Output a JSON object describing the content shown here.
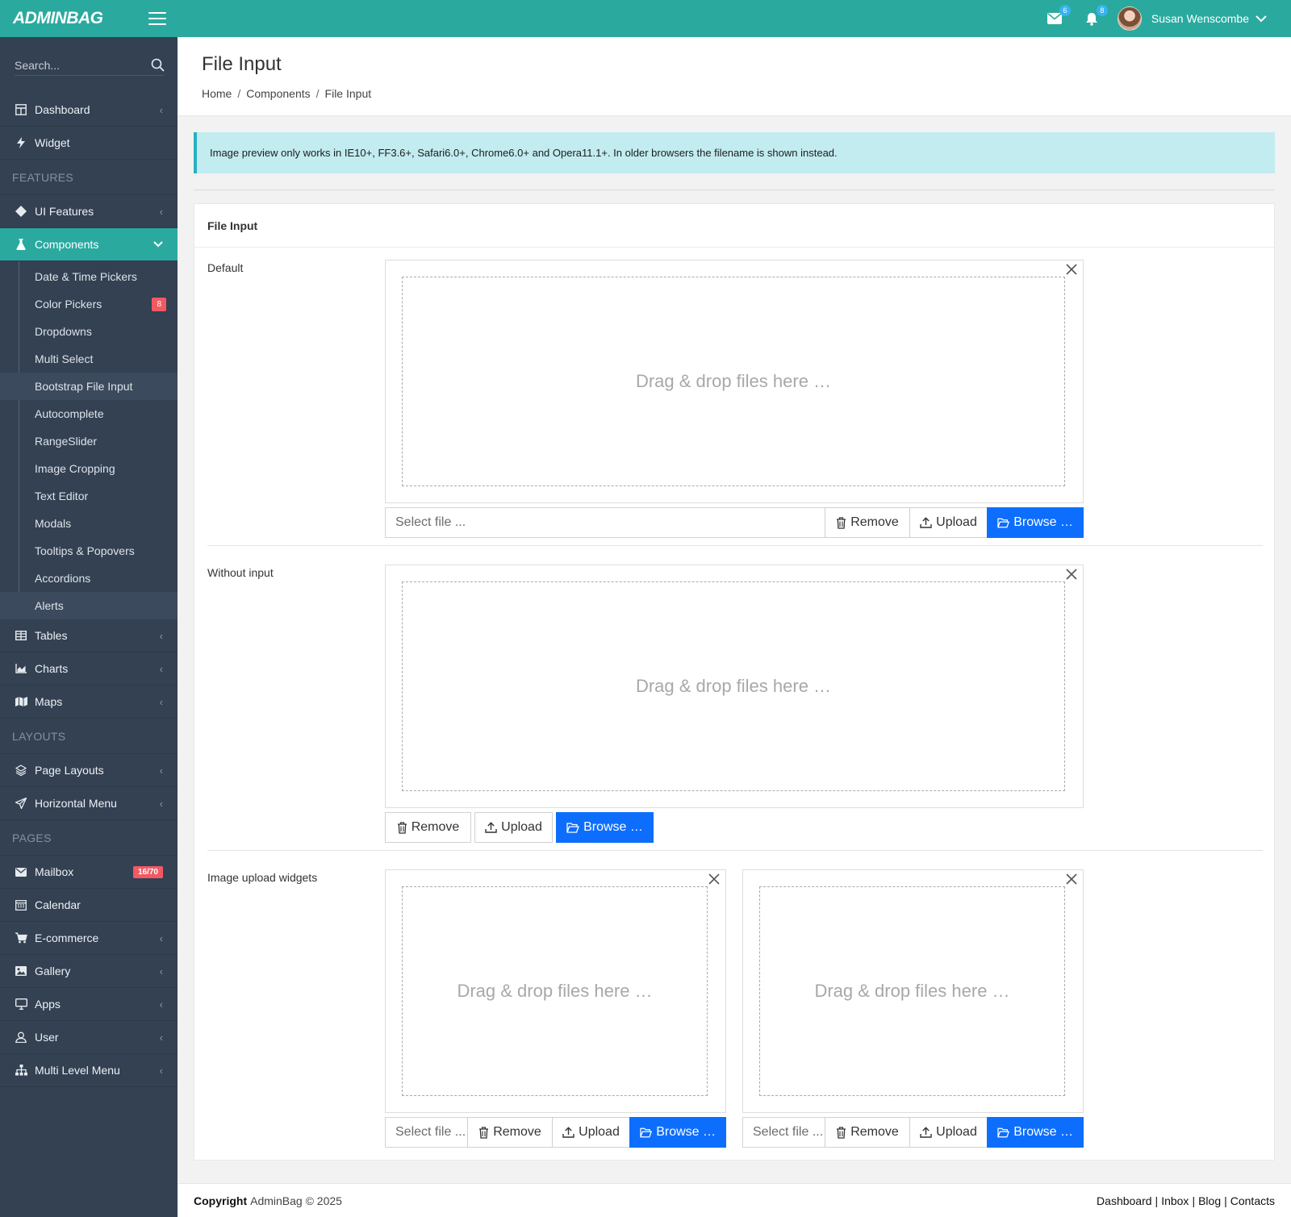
{
  "header": {
    "brand": "ADMINBAG",
    "mail_count": "6",
    "notification_count": "8",
    "username": "Susan Wenscombe"
  },
  "sidebar": {
    "search_placeholder": "Search...",
    "items_top": [
      {
        "label": "Dashboard",
        "icon": "dashboard-icon"
      },
      {
        "label": "Widget",
        "icon": "bolt-icon"
      }
    ],
    "features_header": "FEATURES",
    "ui_features": "UI Features",
    "components": "Components",
    "sub_items": [
      "Date & Time Pickers",
      "Color Pickers",
      "Dropdowns",
      "Multi Select",
      "Bootstrap File Input",
      "Autocomplete",
      "RangeSlider",
      "Image Cropping",
      "Text Editor",
      "Modals",
      "Tooltips & Popovers",
      "Accordions",
      "Alerts"
    ],
    "color_pickers_badge": "8",
    "tables": "Tables",
    "charts": "Charts",
    "maps": "Maps",
    "layouts_header": "LAYOUTS",
    "page_layouts": "Page Layouts",
    "horizontal_menu": "Horizontal Menu",
    "pages_header": "PAGES",
    "mailbox": "Mailbox",
    "mailbox_badge": "16/70",
    "calendar": "Calendar",
    "ecommerce": "E-commerce",
    "gallery": "Gallery",
    "apps": "Apps",
    "user": "User",
    "multi_level_menu": "Multi Level Menu"
  },
  "page": {
    "title": "File Input",
    "breadcrumb": [
      "Home",
      "Components",
      "File Input"
    ],
    "alert": "Image preview only works in IE10+, FF3.6+, Safari6.0+, Chrome6.0+ and Opera11.1+. In older browsers the filename is shown instead.",
    "card_title": "File Input",
    "dropzone_text": "Drag & drop files here …",
    "select_file": "Select file ...",
    "select_file_short": "Select file ...",
    "remove": "Remove",
    "upload": "Upload",
    "browse": "Browse …",
    "rows": {
      "default": "Default",
      "without_input": "Without input",
      "image_widgets": "Image upload widgets"
    }
  },
  "footer": {
    "copyright_label": "Copyright",
    "copyright_text": "AdminBag © 2025",
    "links": [
      "Dashboard",
      "Inbox",
      "Blog",
      "Contacts"
    ]
  },
  "colors": {
    "accent": "#2aaa9f",
    "sidebar_bg": "#334152",
    "primary_button": "#0d6efd",
    "badge_red": "#f15a63",
    "alert_bg": "#c2ecf0"
  }
}
